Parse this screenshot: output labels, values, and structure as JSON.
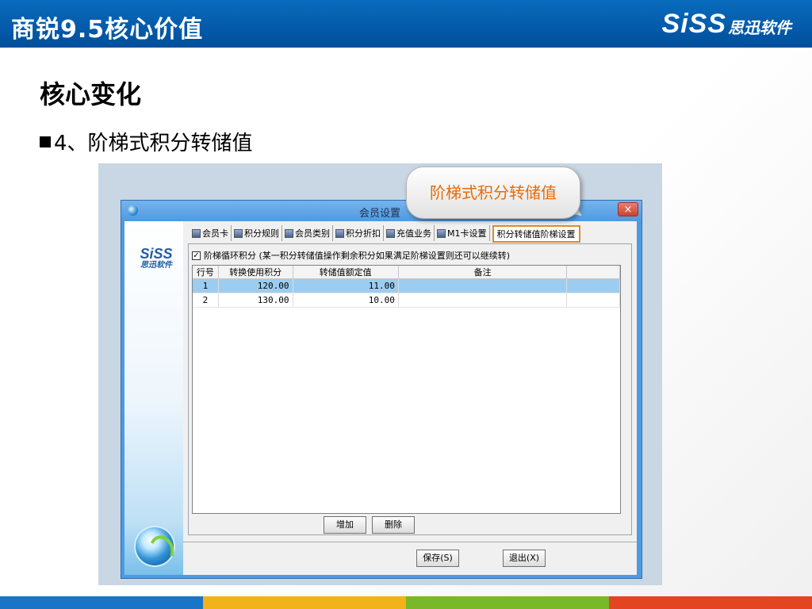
{
  "slide": {
    "title": "商锐9.5核心价值",
    "brand_logo": "SiSS",
    "brand_text": "思迅软件",
    "section_title": "核心变化",
    "bullet": "4、阶梯式积分转储值",
    "callout": "阶梯式积分转储值",
    "strip_colors": [
      "#1a75c6",
      "#f2b21a",
      "#78b82a",
      "#e2451f"
    ]
  },
  "window": {
    "title": "会员设置",
    "close_label": "×",
    "sidebar_logo": "SiSS",
    "sidebar_logo_sub": "思迅软件",
    "tabs": [
      {
        "label": "会员卡"
      },
      {
        "label": "积分规则"
      },
      {
        "label": "会员类别"
      },
      {
        "label": "积分折扣"
      },
      {
        "label": "充值业务"
      },
      {
        "label": "M1卡设置"
      },
      {
        "label": "积分转储值阶梯设置",
        "active": true
      }
    ],
    "checkbox_label": "阶梯循环积分 (某一积分转储值操作剩余积分如果满足阶梯设置则还可以继续转)",
    "checkbox_checked": "✓",
    "table": {
      "columns": [
        "行号",
        "转换使用积分",
        "转储值额定值",
        "备注"
      ],
      "rows": [
        {
          "idx": "1",
          "points": "120.00",
          "value": "11.00",
          "note": ""
        },
        {
          "idx": "2",
          "points": "130.00",
          "value": "10.00",
          "note": ""
        }
      ]
    },
    "add_button": "增加",
    "delete_button": "删除",
    "save_button": "保存(S)",
    "exit_button": "退出(X)"
  }
}
